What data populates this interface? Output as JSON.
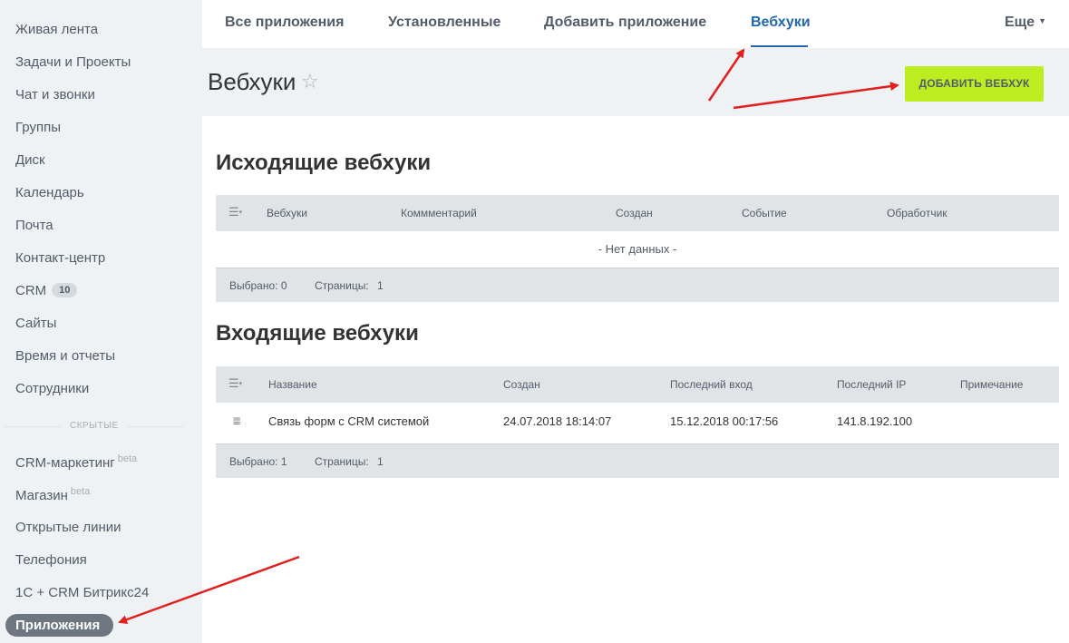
{
  "sidebar": {
    "items": [
      {
        "label": "Живая лента"
      },
      {
        "label": "Задачи и Проекты"
      },
      {
        "label": "Чат и звонки"
      },
      {
        "label": "Группы"
      },
      {
        "label": "Диск"
      },
      {
        "label": "Календарь"
      },
      {
        "label": "Почта"
      },
      {
        "label": "Контакт-центр"
      },
      {
        "label": "CRM",
        "badge": "10"
      },
      {
        "label": "Сайты"
      },
      {
        "label": "Время и отчеты"
      },
      {
        "label": "Сотрудники"
      }
    ],
    "hidden_label": "скрытые",
    "hidden_items": [
      {
        "label": "CRM-маркетинг",
        "sup": "beta"
      },
      {
        "label": "Магазин",
        "sup": "beta"
      },
      {
        "label": "Открытые линии"
      },
      {
        "label": "Телефония"
      },
      {
        "label": "1С + CRM Битрикс24"
      }
    ],
    "active_item": "Приложения"
  },
  "topnav": {
    "tabs": [
      "Все приложения",
      "Установленные",
      "Добавить приложение",
      "Вебхуки"
    ],
    "active_tab": "Вебхуки",
    "more_label": "Еще"
  },
  "header": {
    "title": "Вебхуки",
    "star": "☆",
    "add_button": "ДОБАВИТЬ ВЕБХУК"
  },
  "outgoing": {
    "title": "Исходящие вебхуки",
    "columns": [
      "Вебхуки",
      "Коммментарий",
      "Создан",
      "Событие",
      "Обработчик"
    ],
    "empty_text": "- Нет данных -",
    "footer": {
      "selected": "Выбрано: 0",
      "pages": "Страницы:",
      "pages_value": "1"
    }
  },
  "incoming": {
    "title": "Входящие вебхуки",
    "columns": [
      "Название",
      "Создан",
      "Последний вход",
      "Последний IP",
      "Примечание"
    ],
    "rows": [
      {
        "name": "Связь форм с CRM системой",
        "created": "24.07.2018 18:14:07",
        "last_login": "15.12.2018 00:17:56",
        "last_ip": "141.8.192.100",
        "note": ""
      }
    ],
    "footer": {
      "selected": "Выбрано: 1",
      "pages": "Страницы:",
      "pages_value": "1"
    }
  },
  "colors": {
    "accent": "#2067b0",
    "add_button": "#bbed21",
    "sidebar_bg": "#eef2f4",
    "arrow": "#e01f1f"
  },
  "icons": {
    "grid_menu": "menu-lines-icon",
    "star": "star-icon",
    "caret": "chevron-down-icon"
  }
}
